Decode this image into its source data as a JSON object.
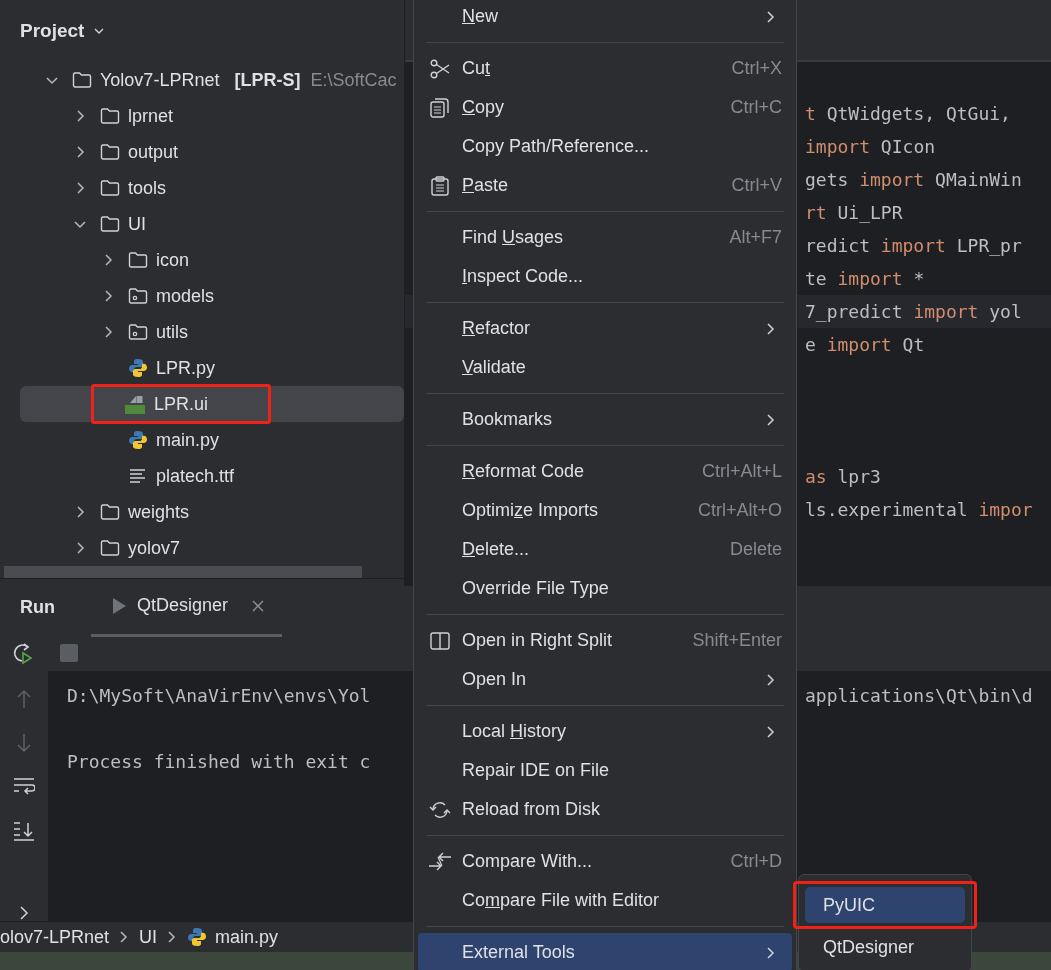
{
  "project": {
    "title": "Project",
    "tree": [
      {
        "kind": "folder",
        "label": "Yolov7-LPRnet",
        "tag": "[LPR-S]",
        "path": "E:\\SoftCac",
        "expanded": true,
        "selected": false,
        "children": [
          {
            "kind": "folder",
            "label": "lprnet",
            "expanded": false,
            "selected": false
          },
          {
            "kind": "folder",
            "label": "output",
            "expanded": false,
            "selected": false
          },
          {
            "kind": "folder",
            "label": "tools",
            "expanded": false,
            "selected": false
          },
          {
            "kind": "folder",
            "label": "UI",
            "expanded": true,
            "selected": false,
            "children": [
              {
                "kind": "folder",
                "label": "icon",
                "expanded": false,
                "selected": false
              },
              {
                "kind": "package",
                "label": "models",
                "expanded": false,
                "selected": false
              },
              {
                "kind": "package",
                "label": "utils",
                "expanded": false,
                "selected": false
              },
              {
                "kind": "python",
                "label": "LPR.py",
                "selected": false
              },
              {
                "kind": "qt",
                "label": "LPR.ui",
                "selected": true,
                "annotated": true
              },
              {
                "kind": "python",
                "label": "main.py",
                "selected": false
              },
              {
                "kind": "text",
                "label": "platech.ttf",
                "selected": false
              }
            ]
          },
          {
            "kind": "folder",
            "label": "weights",
            "expanded": false,
            "selected": false
          },
          {
            "kind": "folder",
            "label": "yolov7",
            "expanded": false,
            "selected": false
          }
        ]
      }
    ]
  },
  "editor": {
    "code_blocks": [
      [
        {
          "tokens": [
            {
              "kind": "keyword",
              "text": "t"
            },
            {
              "kind": "plain",
              "text": " QtWidgets, QtGui,"
            }
          ]
        },
        {
          "tokens": [
            {
              "kind": "keyword",
              "text": " import"
            },
            {
              "kind": "plain",
              "text": " QIcon"
            }
          ]
        },
        {
          "tokens": [
            {
              "kind": "plain",
              "text": "gets "
            },
            {
              "kind": "keyword",
              "text": "import"
            },
            {
              "kind": "plain",
              "text": " QMainWin"
            }
          ]
        },
        {
          "tokens": [
            {
              "kind": "keyword",
              "text": "rt"
            },
            {
              "kind": "plain",
              "text": " Ui_LPR"
            }
          ]
        },
        {
          "tokens": [
            {
              "kind": "plain",
              "text": "redict "
            },
            {
              "kind": "keyword",
              "text": "import"
            },
            {
              "kind": "plain",
              "text": " LPR_pr"
            }
          ]
        },
        {
          "tokens": [
            {
              "kind": "plain",
              "text": "te "
            },
            {
              "kind": "keyword",
              "text": "import"
            },
            {
              "kind": "plain",
              "text": " *"
            }
          ]
        },
        {
          "current": true,
          "tokens": [
            {
              "kind": "plain",
              "text": "7_predict "
            },
            {
              "kind": "keyword",
              "text": "import"
            },
            {
              "kind": "plain",
              "text": " yol"
            }
          ]
        },
        {
          "tokens": [
            {
              "kind": "plain",
              "text": "e "
            },
            {
              "kind": "keyword",
              "text": "import"
            },
            {
              "kind": "plain",
              "text": " Qt"
            }
          ]
        }
      ],
      [
        {
          "tokens": [
            {
              "kind": "keyword",
              "text": " as"
            },
            {
              "kind": "plain",
              "text": " lpr3"
            }
          ]
        },
        {
          "tokens": [
            {
              "kind": "plain",
              "text": "ls.experimental "
            },
            {
              "kind": "keyword",
              "text": "impor"
            }
          ]
        }
      ]
    ]
  },
  "run": {
    "title": "Run",
    "tabs": [
      {
        "label": "QtDesigner",
        "selected": true
      }
    ],
    "console": [
      {
        "text": "D:\\MySoft\\AnaVirEnv\\envs\\Yol",
        "tail": "applications\\Qt\\bin\\d"
      },
      {
        "text": "Process finished with exit c"
      }
    ]
  },
  "breadcrumb": [
    {
      "kind": "plain",
      "label": "olov7-LPRnet"
    },
    {
      "kind": "plain",
      "label": "UI"
    },
    {
      "kind": "python",
      "label": "main.py"
    }
  ],
  "context_menu": {
    "groups": [
      [
        {
          "key": "N",
          "post": "ew",
          "submenu": true
        }
      ],
      [
        {
          "kind": "scissors",
          "pre": "Cu",
          "key": "t",
          "shortcut": "Ctrl+X"
        },
        {
          "kind": "copy",
          "key": "C",
          "post": "opy",
          "shortcut": "Ctrl+C"
        },
        {
          "post": "Copy Path/Reference..."
        },
        {
          "kind": "paste",
          "key": "P",
          "post": "aste",
          "shortcut": "Ctrl+V"
        }
      ],
      [
        {
          "pre": "Find ",
          "key": "U",
          "post": "sages",
          "shortcut": "Alt+F7"
        },
        {
          "key": "I",
          "post": "nspect Code..."
        }
      ],
      [
        {
          "key": "R",
          "post": "efactor",
          "submenu": true
        },
        {
          "key": "V",
          "post": "alidate"
        }
      ],
      [
        {
          "post": "Bookmarks",
          "submenu": true
        }
      ],
      [
        {
          "key": "R",
          "post": "eformat Code",
          "shortcut": "Ctrl+Alt+L"
        },
        {
          "pre": "Optimi",
          "key": "z",
          "post": "e Imports",
          "shortcut": "Ctrl+Alt+O"
        },
        {
          "key": "D",
          "post": "elete...",
          "shortcut": "Delete"
        },
        {
          "post": "Override File Type"
        }
      ],
      [
        {
          "kind": "split",
          "post": "Open in Right Split",
          "shortcut": "Shift+Enter"
        },
        {
          "post": "Open In",
          "submenu": true
        }
      ],
      [
        {
          "pre": "Local ",
          "key": "H",
          "post": "istory",
          "submenu": true
        },
        {
          "post": "Repair IDE on File"
        },
        {
          "kind": "reload",
          "post": "Reload from Disk"
        }
      ],
      [
        {
          "kind": "compare",
          "post": "Compare With...",
          "shortcut": "Ctrl+D"
        },
        {
          "pre": "Co",
          "key": "m",
          "post": "pare File with Editor"
        }
      ],
      [
        {
          "post": "External Tools",
          "submenu": true,
          "selected": true
        }
      ]
    ]
  },
  "submenu": {
    "items": [
      {
        "label": "PyUIC",
        "selected": true,
        "annotated": true
      },
      {
        "label": "QtDesigner",
        "selected": false
      }
    ]
  }
}
